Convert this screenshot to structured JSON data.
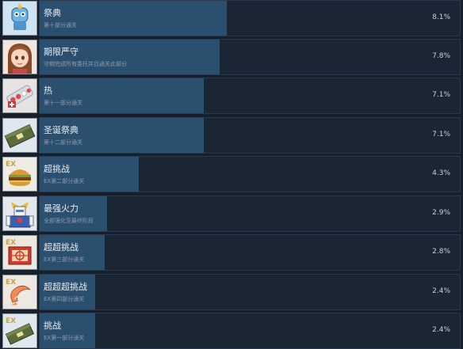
{
  "achievements": [
    {
      "name": "祭典",
      "desc": "第十部分通关",
      "percent": "8.1%",
      "rate": 0.081,
      "icon": "robot-mascot-icon"
    },
    {
      "name": "期限严守",
      "desc": "守期完成所有委托并且通关此部分",
      "percent": "7.8%",
      "rate": 0.078,
      "icon": "anime-girl-portrait-icon"
    },
    {
      "name": "热",
      "desc": "第十一部分通关",
      "percent": "7.1%",
      "rate": 0.071,
      "icon": "medicine-pills-icon"
    },
    {
      "name": "圣诞祭典",
      "desc": "第十二部分通关",
      "percent": "7.1%",
      "rate": 0.071,
      "icon": "ammo-crate-icon"
    },
    {
      "name": "超挑战",
      "desc": "EX第二部分通关",
      "percent": "4.3%",
      "rate": 0.043,
      "icon": "burger-icon"
    },
    {
      "name": "最强火力",
      "desc": "全部强化至最终阶段",
      "percent": "2.9%",
      "rate": 0.029,
      "icon": "mecha-robot-icon"
    },
    {
      "name": "超超挑战",
      "desc": "EX第三部分通关",
      "percent": "2.8%",
      "rate": 0.028,
      "icon": "target-tile-icon"
    },
    {
      "name": "超超超挑战",
      "desc": "EX第四部分通关",
      "percent": "2.4%",
      "rate": 0.024,
      "icon": "shrimp-icon"
    },
    {
      "name": "挑战",
      "desc": "EX第一部分通关",
      "percent": "2.4%",
      "rate": 0.024,
      "icon": "ex-ammo-crate-icon"
    }
  ]
}
